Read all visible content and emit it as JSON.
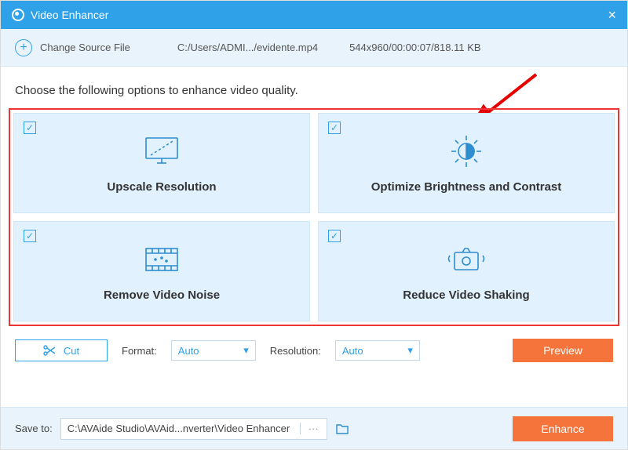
{
  "titlebar": {
    "title": "Video Enhancer"
  },
  "sourcebar": {
    "change": "Change Source File",
    "path": "C:/Users/ADMI.../evidente.mp4",
    "meta": "544x960/00:00:07/818.11 KB"
  },
  "instruction": "Choose the following options to enhance video quality.",
  "options": {
    "upscale": "Upscale Resolution",
    "brightness": "Optimize Brightness and Contrast",
    "noise": "Remove Video Noise",
    "shaking": "Reduce Video Shaking"
  },
  "toolbar": {
    "cut": "Cut",
    "format_label": "Format:",
    "format_value": "Auto",
    "resolution_label": "Resolution:",
    "resolution_value": "Auto",
    "preview": "Preview"
  },
  "footer": {
    "saveto_label": "Save to:",
    "saveto_path": "C:\\AVAide Studio\\AVAid...nverter\\Video Enhancer",
    "dots": "···",
    "enhance": "Enhance"
  }
}
